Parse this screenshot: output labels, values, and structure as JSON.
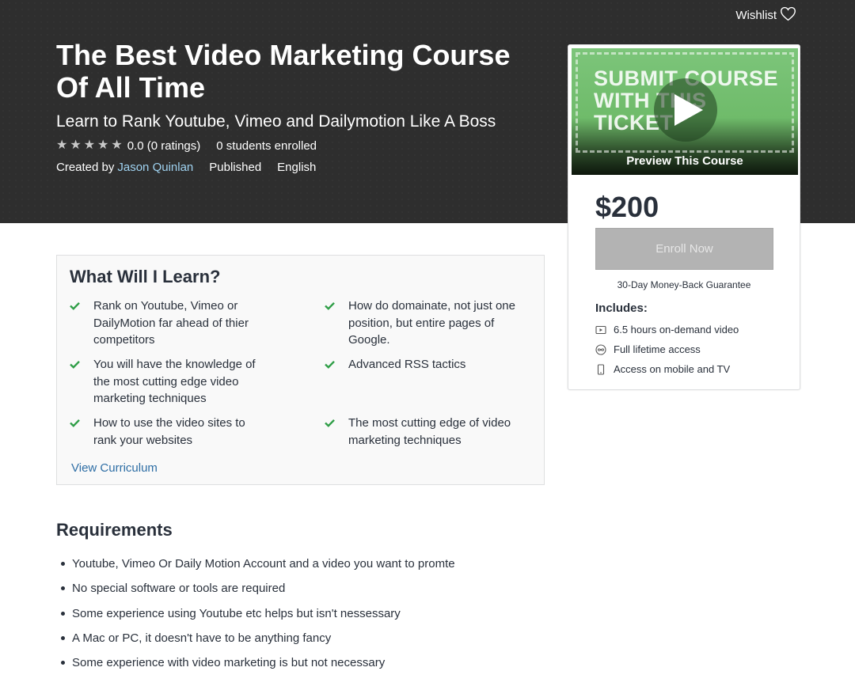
{
  "header": {
    "wishlist_label": "Wishlist",
    "title": "The Best Video Marketing Course Of All Time",
    "subtitle": "Learn to Rank Youtube, Vimeo and Dailymotion Like A Boss",
    "rating_text": "0.0 (0 ratings)",
    "rating_value": 0.0,
    "stars_total": 5,
    "students": "0 students enrolled",
    "created_by_label": "Created by",
    "instructor": "Jason Quinlan",
    "status": "Published",
    "language": "English"
  },
  "sidebar": {
    "preview_image_text": [
      "SUBMIT COURSE",
      "WITH THIS",
      "TICKET"
    ],
    "preview_label": "Preview This Course",
    "price": "$200",
    "enroll_label": "Enroll Now",
    "guarantee": "30-Day Money-Back Guarantee",
    "includes_title": "Includes:",
    "includes": [
      {
        "icon": "video-icon",
        "label": "6.5 hours on-demand video"
      },
      {
        "icon": "infinity-icon",
        "label": "Full lifetime access"
      },
      {
        "icon": "mobile-icon",
        "label": "Access on mobile and TV"
      }
    ]
  },
  "learn": {
    "title": "What Will I Learn?",
    "items": [
      [
        "Rank on Youtube, Vimeo or",
        "DailyMotion far ahead of thier",
        "competitors"
      ],
      [
        "How do domainate, not just one",
        "position, but entire pages of",
        "Google."
      ],
      [
        "You will have the knowledge of",
        "the most cutting edge video",
        "marketing techniques"
      ],
      [
        "Advanced RSS tactics"
      ],
      [
        "How to use the video sites to",
        "rank your websites"
      ],
      [
        "The most cutting edge of video",
        "marketing techniques"
      ]
    ],
    "view_curriculum": "View Curriculum"
  },
  "requirements": {
    "title": "Requirements",
    "items": [
      "Youtube, Vimeo Or Daily Motion Account and a video you want to promte",
      "No special software or tools are required",
      "Some experience using Youtube etc helps but isn't nessessary",
      "A Mac or PC, it doesn't have to be anything fancy",
      "Some experience with video marketing is but not necessary"
    ]
  },
  "colors": {
    "hero_bg": "#2e2e2e",
    "link": "#2e6ea5",
    "instructor_link": "#9fd2f0",
    "check": "#2f9e47",
    "enroll_disabled": "#b3b3b3"
  }
}
